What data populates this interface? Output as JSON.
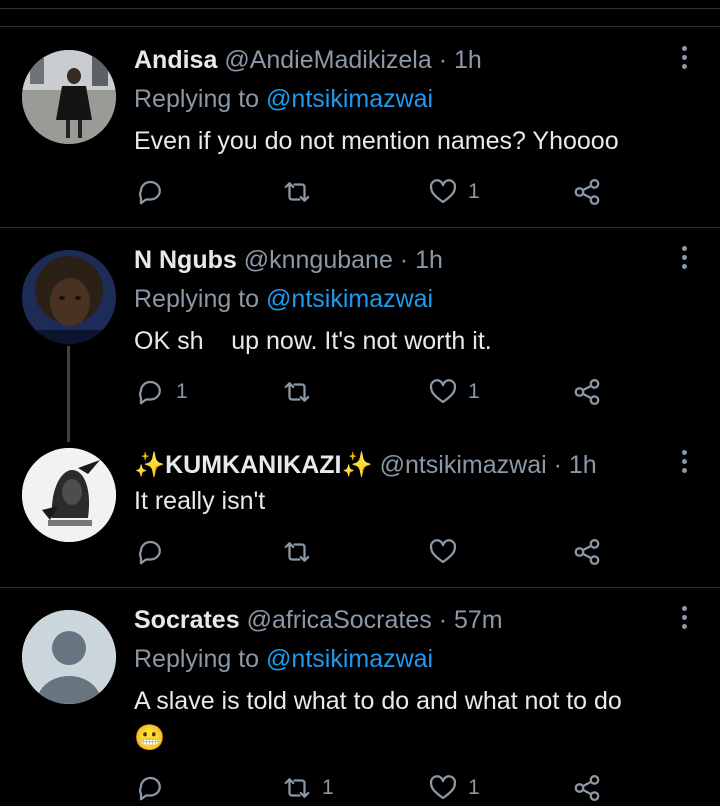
{
  "tweets": [
    {
      "name": "Andisa",
      "handle": "@AndieMadikizela",
      "time": "· 1h",
      "reply_prefix": "Replying to",
      "reply_to": "@ntsikimazwai",
      "text": "Even if you do not mention names? Yhoooo",
      "replies": "",
      "retweets": "",
      "likes": "1"
    },
    {
      "name": "N Ngubs",
      "handle": "@knngubane",
      "time": "· 1h",
      "reply_prefix": "Replying to",
      "reply_to": "@ntsikimazwai",
      "text": "OK sh    up now. It's not worth it.",
      "replies": "1",
      "retweets": "",
      "likes": "1"
    },
    {
      "name": "✨KUMKANIKAZI✨",
      "handle": "@ntsikimazwai",
      "time": "· 1h",
      "text": "It really isn't",
      "replies": "",
      "retweets": "",
      "likes": ""
    },
    {
      "name": "Socrates",
      "handle": "@africaSocrates",
      "time": "· 57m",
      "reply_prefix": "Replying to",
      "reply_to": "@ntsikimazwai",
      "text": "A slave is told what to do and what not to do",
      "emoji": "😬",
      "replies": "",
      "retweets": "1",
      "likes": "1"
    }
  ],
  "icons": [
    "reply-icon",
    "retweet-icon",
    "like-icon",
    "share-icon",
    "more-icon"
  ],
  "colors": {
    "background": "#000000",
    "text": "#e7e9ea",
    "muted": "#8b98a5",
    "link": "#1d9bf0",
    "divider": "#2f3336"
  }
}
